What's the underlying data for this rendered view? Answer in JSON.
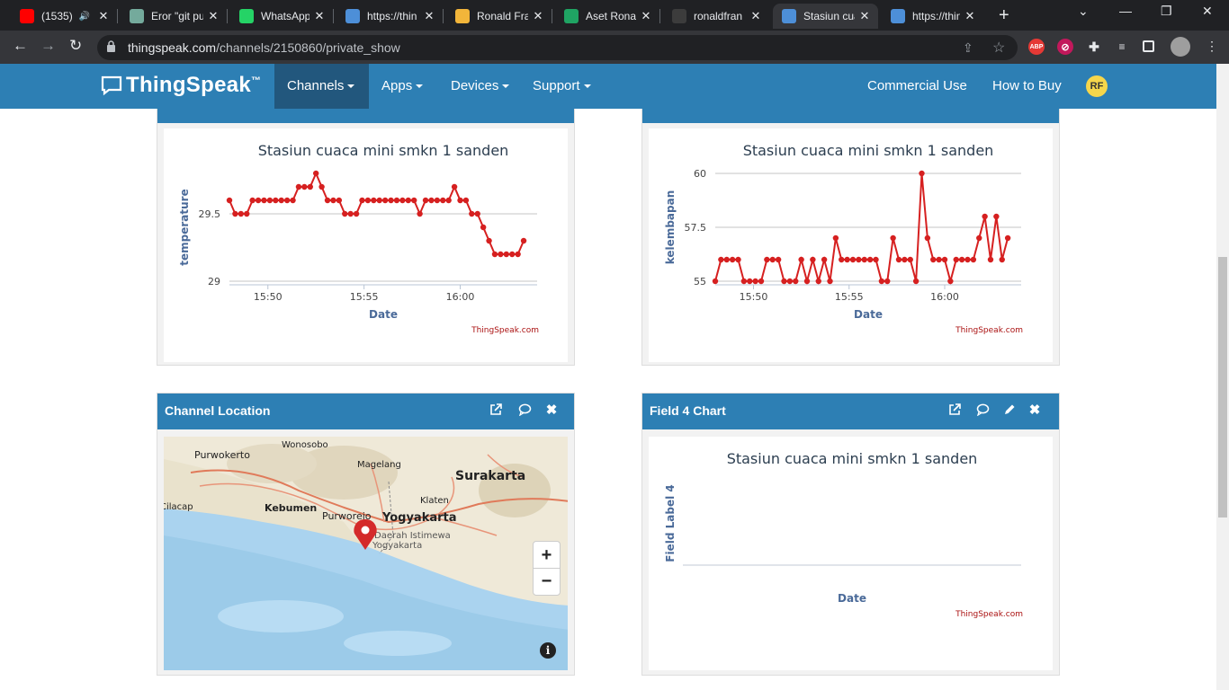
{
  "browser": {
    "tabs": [
      {
        "title": "(1535)",
        "icon": "youtube-icon",
        "color": "#ff0000"
      },
      {
        "title": "Eror \"git pu",
        "icon": "chatgpt-icon",
        "color": "#74aa9c"
      },
      {
        "title": "WhatsApp",
        "icon": "whatsapp-icon",
        "color": "#25d366"
      },
      {
        "title": "https://thin",
        "icon": "chat-icon",
        "color": "#4d8fd8"
      },
      {
        "title": "Ronald Fra",
        "icon": "clock-icon",
        "color": "#f2b53a"
      },
      {
        "title": "Aset Ronal",
        "icon": "drive-icon",
        "color": "#1fa463"
      },
      {
        "title": "ronaldfran",
        "icon": "github-icon",
        "color": "#3c3c3c"
      },
      {
        "title": "Stasiun cua",
        "icon": "chat-icon",
        "color": "#4d8fd8"
      },
      {
        "title": "https://thin",
        "icon": "chat-icon",
        "color": "#4d8fd8"
      }
    ],
    "url_host": "thingspeak.com",
    "url_path": "/channels/2150860/private_show"
  },
  "nav": {
    "logo": "ThingSpeak",
    "tm": "™",
    "channels": "Channels",
    "apps": "Apps",
    "devices": "Devices",
    "support": "Support",
    "commercial": "Commercial Use",
    "howtobuy": "How to Buy",
    "avatar": "RF"
  },
  "panels": {
    "location_title": "Channel Location",
    "field4_title": "Field 4 Chart"
  },
  "map": {
    "labels": [
      "Purwokerto",
      "Wonosobo",
      "Magelang",
      "Surakarta",
      "Klaten",
      "Cilacap",
      "Kebumen",
      "Purworejo",
      "Yogyakarta",
      "Daerah Istimewa",
      "Yogyakarta"
    ],
    "zoom_in": "+",
    "zoom_out": "−"
  },
  "chart_common": {
    "title": "Stasiun cuaca mini smkn 1 sanden",
    "xlabel": "Date",
    "credit": "ThingSpeak.com",
    "xticks": [
      "15:50",
      "15:55",
      "16:00"
    ]
  },
  "chart_data": [
    {
      "type": "line",
      "title": "Stasiun cuaca mini smkn 1 sanden",
      "xlabel": "Date",
      "ylabel": "temperature",
      "color": "#d62020",
      "yticks": [
        "29.5",
        "29"
      ],
      "ylim": [
        29,
        29.8
      ],
      "xlim_min": [
        0,
        16
      ],
      "x_min": [
        0.0,
        0.3,
        0.6,
        0.9,
        1.2,
        1.5,
        1.8,
        2.1,
        2.4,
        2.7,
        3.0,
        3.3,
        3.6,
        3.9,
        4.2,
        4.5,
        4.8,
        5.1,
        5.4,
        5.7,
        6.0,
        6.3,
        6.6,
        6.9,
        7.2,
        7.5,
        7.8,
        8.1,
        8.4,
        8.7,
        9.0,
        9.3,
        9.6,
        9.9,
        10.2,
        10.5,
        10.8,
        11.1,
        11.4,
        11.7,
        12.0,
        12.3,
        12.6,
        12.9,
        13.2,
        13.5,
        13.8,
        14.1,
        14.4,
        14.7,
        15.0,
        15.3
      ],
      "values": [
        29.6,
        29.5,
        29.5,
        29.5,
        29.6,
        29.6,
        29.6,
        29.6,
        29.6,
        29.6,
        29.6,
        29.6,
        29.7,
        29.7,
        29.7,
        29.8,
        29.7,
        29.6,
        29.6,
        29.6,
        29.5,
        29.5,
        29.5,
        29.6,
        29.6,
        29.6,
        29.6,
        29.6,
        29.6,
        29.6,
        29.6,
        29.6,
        29.6,
        29.5,
        29.6,
        29.6,
        29.6,
        29.6,
        29.6,
        29.7,
        29.6,
        29.6,
        29.5,
        29.5,
        29.4,
        29.3,
        29.2,
        29.2,
        29.2,
        29.2,
        29.2,
        29.3
      ]
    },
    {
      "type": "line",
      "title": "Stasiun cuaca mini smkn 1 sanden",
      "xlabel": "Date",
      "ylabel": "kelembapan",
      "color": "#d62020",
      "yticks": [
        "60",
        "57.5",
        "55"
      ],
      "ylim": [
        55,
        60
      ],
      "xlim_min": [
        0,
        16
      ],
      "x_min": [
        0.0,
        0.3,
        0.6,
        0.9,
        1.2,
        1.5,
        1.8,
        2.1,
        2.4,
        2.7,
        3.0,
        3.3,
        3.6,
        3.9,
        4.2,
        4.5,
        4.8,
        5.1,
        5.4,
        5.7,
        6.0,
        6.3,
        6.6,
        6.9,
        7.2,
        7.5,
        7.8,
        8.1,
        8.4,
        8.7,
        9.0,
        9.3,
        9.6,
        9.9,
        10.2,
        10.5,
        10.8,
        11.1,
        11.4,
        11.7,
        12.0,
        12.3,
        12.6,
        12.9,
        13.2,
        13.5,
        13.8,
        14.1,
        14.4,
        14.7,
        15.0,
        15.3
      ],
      "values": [
        55,
        56,
        56,
        56,
        56,
        55,
        55,
        55,
        55,
        56,
        56,
        56,
        55,
        55,
        55,
        56,
        55,
        56,
        55,
        56,
        55,
        57,
        56,
        56,
        56,
        56,
        56,
        56,
        56,
        55,
        55,
        57,
        56,
        56,
        56,
        55,
        60,
        57,
        56,
        56,
        56,
        55,
        56,
        56,
        56,
        56,
        57,
        58,
        56,
        58,
        56,
        57
      ]
    },
    {
      "type": "line",
      "title": "Stasiun cuaca mini smkn 1 sanden",
      "xlabel": "Date",
      "ylabel": "Field Label 4",
      "values": []
    }
  ]
}
